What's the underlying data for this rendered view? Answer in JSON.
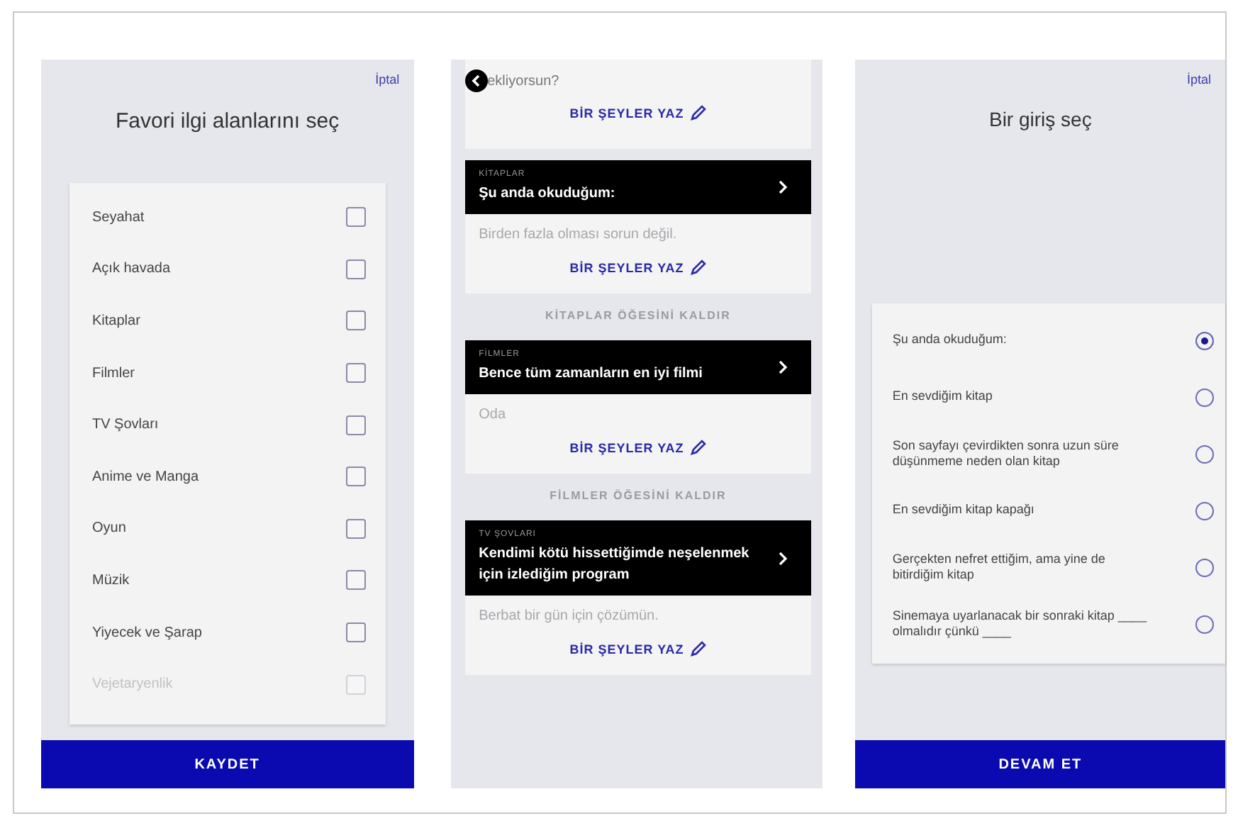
{
  "interests_screen": {
    "cancel": "İptal",
    "title": "Favori ilgi alanlarını seç",
    "items": [
      {
        "label": "Seyahat",
        "checked": false,
        "disabled": false
      },
      {
        "label": "Açık havada",
        "checked": false,
        "disabled": false
      },
      {
        "label": "Kitaplar",
        "checked": false,
        "disabled": false
      },
      {
        "label": "Filmler",
        "checked": false,
        "disabled": false
      },
      {
        "label": "TV Şovları",
        "checked": false,
        "disabled": false
      },
      {
        "label": "Anime ve Manga",
        "checked": false,
        "disabled": false
      },
      {
        "label": "Oyun",
        "checked": false,
        "disabled": false
      },
      {
        "label": "Müzik",
        "checked": false,
        "disabled": false
      },
      {
        "label": "Yiyecek ve Şarap",
        "checked": false,
        "disabled": false
      },
      {
        "label": "Vejetaryenlik",
        "checked": false,
        "disabled": true
      }
    ],
    "button": "KAYDET"
  },
  "entries_screen": {
    "top_card": {
      "text": "ekliyorsun?",
      "action": "BİR ŞEYLER YAZ"
    },
    "entries": [
      {
        "category": "KİTAPLAR",
        "title": "Şu anda okuduğum:",
        "hint": "Birden fazla olması sorun değil.",
        "action": "BİR ŞEYLER YAZ",
        "remove": "KİTAPLAR ÖĞESİNİ KALDIR"
      },
      {
        "category": "FİLMLER",
        "title": "Bence tüm zamanların en iyi filmi",
        "hint": "Oda",
        "action": "BİR ŞEYLER YAZ",
        "remove": "FİLMLER ÖĞESİNİ KALDIR"
      },
      {
        "category": "TV ŞOVLARI",
        "title": "Kendimi kötü hissettiğimde neşelenmek için izlediğim program",
        "hint": "Berbat bir gün için çözümün.",
        "action": "BİR ŞEYLER YAZ"
      }
    ]
  },
  "prompt_screen": {
    "cancel": "İptal",
    "title": "Bir giriş seç",
    "options": [
      {
        "label": "Şu anda okuduğum:",
        "selected": true
      },
      {
        "label": "En sevdiğim kitap",
        "selected": false
      },
      {
        "label": "Son sayfayı çevirdikten sonra uzun süre düşünmeme neden olan kitap",
        "selected": false
      },
      {
        "label": "En sevdiğim kitap kapağı",
        "selected": false
      },
      {
        "label": "Gerçekten nefret ettiğim, ama yine de bitirdiğim kitap",
        "selected": false
      },
      {
        "label": "Sinemaya uyarlanacak bir sonraki kitap ____ olmalıdır çünkü ____",
        "selected": false
      }
    ],
    "button": "DEVAM ET"
  }
}
